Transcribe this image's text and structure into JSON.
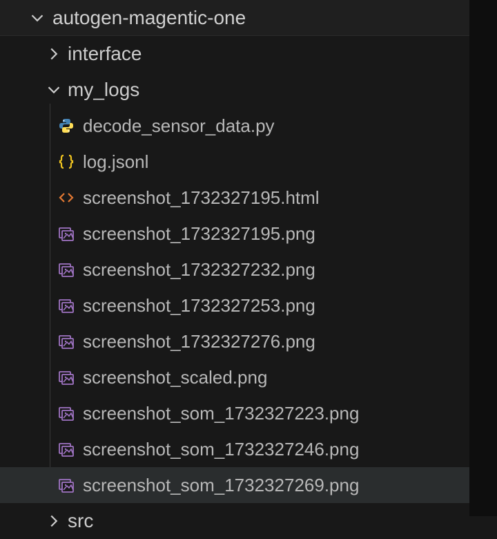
{
  "root": {
    "label": "autogen-magentic-one"
  },
  "folders": [
    {
      "label": "interface",
      "expanded": false
    },
    {
      "label": "my_logs",
      "expanded": true
    }
  ],
  "files": [
    {
      "label": "decode_sensor_data.py",
      "icon": "python",
      "selected": false
    },
    {
      "label": "log.jsonl",
      "icon": "json",
      "selected": false
    },
    {
      "label": "screenshot_1732327195.html",
      "icon": "html",
      "selected": false
    },
    {
      "label": "screenshot_1732327195.png",
      "icon": "image",
      "selected": false
    },
    {
      "label": "screenshot_1732327232.png",
      "icon": "image",
      "selected": false
    },
    {
      "label": "screenshot_1732327253.png",
      "icon": "image",
      "selected": false
    },
    {
      "label": "screenshot_1732327276.png",
      "icon": "image",
      "selected": false
    },
    {
      "label": "screenshot_scaled.png",
      "icon": "image",
      "selected": false
    },
    {
      "label": "screenshot_som_1732327223.png",
      "icon": "image",
      "selected": false
    },
    {
      "label": "screenshot_som_1732327246.png",
      "icon": "image",
      "selected": false
    },
    {
      "label": "screenshot_som_1732327269.png",
      "icon": "image",
      "selected": true
    }
  ],
  "lastFolder": {
    "label": "src",
    "expanded": false
  },
  "colors": {
    "python_primary": "#4584b6",
    "python_secondary": "#ffde57",
    "json": "#f0c420",
    "html": "#e37933",
    "image": "#a074c4"
  }
}
